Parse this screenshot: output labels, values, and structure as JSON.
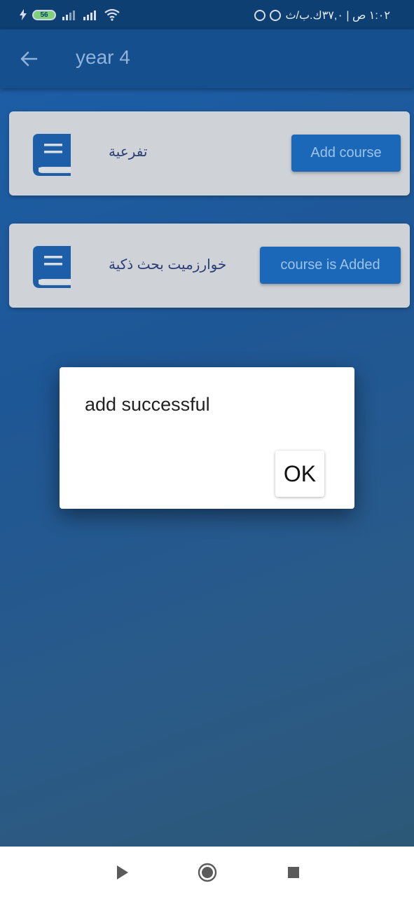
{
  "status_bar": {
    "battery_level": "56",
    "right_text": "١:٠٢ ص | ٣٧,٠ك.ب/ث"
  },
  "app_bar": {
    "title": "year 4",
    "back_icon": "arrow-back-icon"
  },
  "courses": [
    {
      "title": "تفرعية",
      "button_label": "Add course",
      "icon": "book-icon"
    },
    {
      "title": "خوارزميت بحث  ذكية",
      "button_label": "course is Added",
      "icon": "book-icon"
    }
  ],
  "dialog": {
    "message": "add successful",
    "ok_label": "OK"
  },
  "colors": {
    "accent": "#1c68b8",
    "app_bar": "#154f8e",
    "status_bar": "#0e3f73"
  }
}
